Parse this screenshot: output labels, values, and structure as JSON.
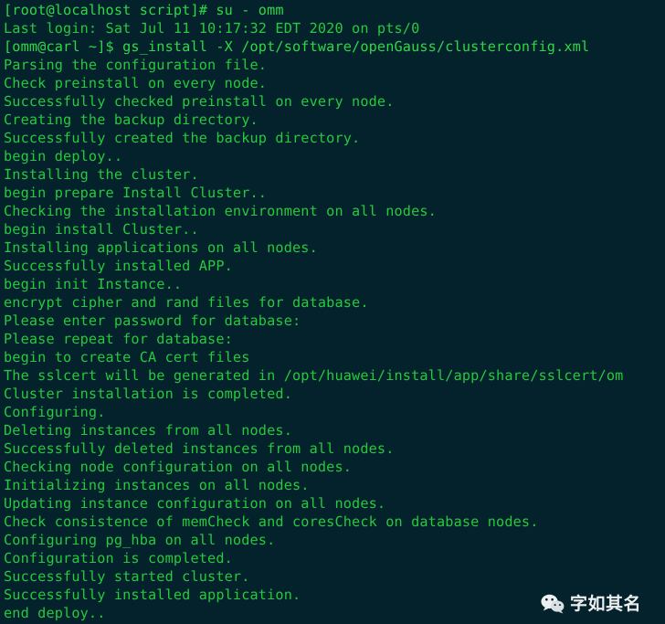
{
  "terminal": {
    "background_color": "#04222b",
    "text_color": "#26c93f",
    "lines": [
      "[root@localhost script]# su - omm",
      "Last login: Sat Jul 11 10:17:32 EDT 2020 on pts/0",
      "[omm@carl ~]$ gs_install -X /opt/software/openGauss/clusterconfig.xml",
      "Parsing the configuration file.",
      "Check preinstall on every node.",
      "Successfully checked preinstall on every node.",
      "Creating the backup directory.",
      "Successfully created the backup directory.",
      "begin deploy..",
      "Installing the cluster.",
      "begin prepare Install Cluster..",
      "Checking the installation environment on all nodes.",
      "begin install Cluster..",
      "Installing applications on all nodes.",
      "Successfully installed APP.",
      "begin init Instance..",
      "encrypt cipher and rand files for database.",
      "Please enter password for database:",
      "Please repeat for database:",
      "begin to create CA cert files",
      "The sslcert will be generated in /opt/huawei/install/app/share/sslcert/om",
      "Cluster installation is completed.",
      "Configuring.",
      "Deleting instances from all nodes.",
      "Successfully deleted instances from all nodes.",
      "Checking node configuration on all nodes.",
      "Initializing instances on all nodes.",
      "Updating instance configuration on all nodes.",
      "Check consistence of memCheck and coresCheck on database nodes.",
      "Configuring pg_hba on all nodes.",
      "Configuration is completed.",
      "Successfully started cluster.",
      "Successfully installed application.",
      "end deploy.."
    ]
  },
  "watermark": {
    "icon": "wechat-icon",
    "text": "字如其名",
    "text_color": "#ffffff"
  }
}
